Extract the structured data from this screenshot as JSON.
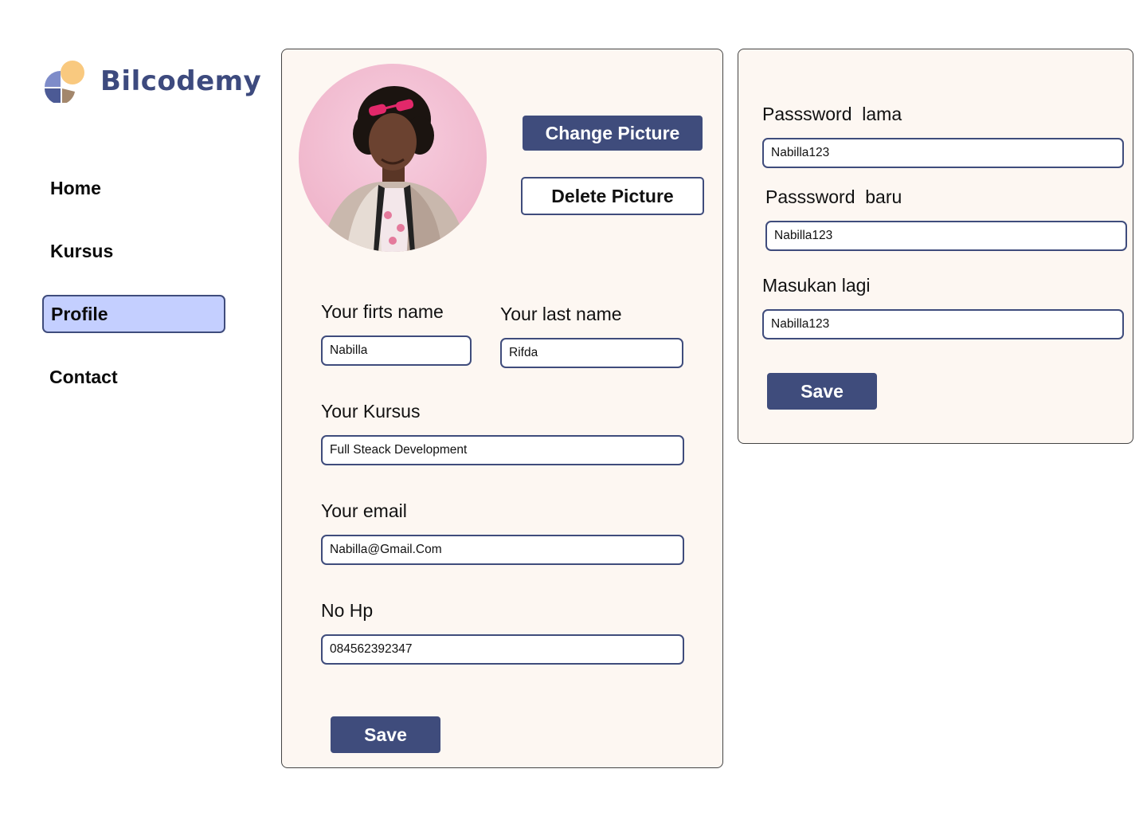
{
  "brand": {
    "name": "Bilcodemy",
    "colors": {
      "accent": "#3f4c7c",
      "active_bg": "#c4cfff",
      "card_bg": "#fdf7f2"
    }
  },
  "nav": {
    "items": [
      {
        "label": "Home"
      },
      {
        "label": "Kursus"
      },
      {
        "label": "Profile",
        "active": true
      },
      {
        "label": "Contact"
      }
    ]
  },
  "profile": {
    "avatar_icon": "user-photo",
    "change_picture_label": "Change Picture",
    "delete_picture_label": "Delete Picture",
    "first_name": {
      "label": "Your firts name",
      "value": "Nabilla"
    },
    "last_name": {
      "label": "Your last name",
      "value": "Rifda"
    },
    "kursus": {
      "label": "Your Kursus",
      "value": "Full Steack Development"
    },
    "email": {
      "label": "Your email",
      "value": "Nabilla@Gmail.Com"
    },
    "phone": {
      "label": "No Hp",
      "value": "084562392347"
    },
    "save_label": "Save"
  },
  "password": {
    "old": {
      "label": "Passsword  lama",
      "value": "Nabilla123"
    },
    "new": {
      "label": "Passsword  baru",
      "value": "Nabilla123"
    },
    "repeat": {
      "label": "Masukan lagi",
      "value": "Nabilla123"
    },
    "save_label": "Save"
  }
}
